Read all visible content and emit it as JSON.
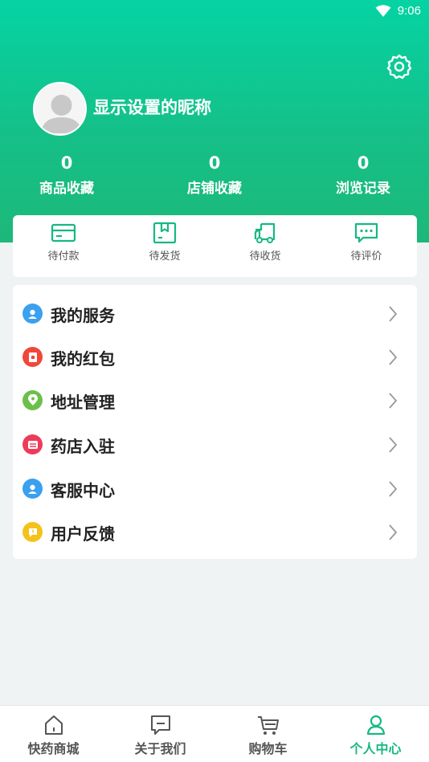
{
  "status_bar": {
    "time": "9:06"
  },
  "profile": {
    "nickname": "显示设置的昵称"
  },
  "stats": [
    {
      "value": "0",
      "label": "商品收藏"
    },
    {
      "value": "0",
      "label": "店铺收藏"
    },
    {
      "value": "0",
      "label": "浏览记录"
    }
  ],
  "orders": [
    {
      "label": "待付款",
      "icon": "card-icon"
    },
    {
      "label": "待发货",
      "icon": "package-icon"
    },
    {
      "label": "待收货",
      "icon": "truck-icon"
    },
    {
      "label": "待评价",
      "icon": "comment-icon"
    }
  ],
  "menu": [
    {
      "label": "我的服务",
      "icon": "service-icon",
      "color": "#3aa0f0"
    },
    {
      "label": "我的红包",
      "icon": "red-packet-icon",
      "color": "#f0473a"
    },
    {
      "label": "地址管理",
      "icon": "location-icon",
      "color": "#6cc04a"
    },
    {
      "label": "药店入驻",
      "icon": "store-icon",
      "color": "#ee3b5a"
    },
    {
      "label": "客服中心",
      "icon": "customer-service-icon",
      "color": "#3aa0f0"
    },
    {
      "label": "用户反馈",
      "icon": "feedback-icon",
      "color": "#f5c21b"
    }
  ],
  "tabs": [
    {
      "label": "快药商城",
      "icon": "home-icon",
      "active": false
    },
    {
      "label": "关于我们",
      "icon": "about-icon",
      "active": false
    },
    {
      "label": "购物车",
      "icon": "cart-icon",
      "active": false
    },
    {
      "label": "个人中心",
      "icon": "person-icon",
      "active": true
    }
  ],
  "colors": {
    "brand": "#16b980",
    "header_top": "#05d3a3",
    "background": "#f0f3f3"
  }
}
